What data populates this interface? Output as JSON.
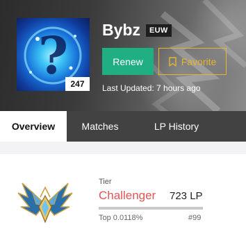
{
  "profile": {
    "name": "Bybz",
    "region": "EUW",
    "level": "247",
    "renew_label": "Renew",
    "favorite_label": "Favorite",
    "last_updated": "Last Updated: 7 hours ago",
    "avatar_icon": "question-mark-orb-icon",
    "favorite_icon": "bookmark-icon"
  },
  "tabs": [
    {
      "label": "Overview",
      "active": true
    },
    {
      "label": "Matches",
      "active": false
    },
    {
      "label": "LP History",
      "active": false
    }
  ],
  "rank": {
    "tier_label": "Tier",
    "tier": "Challenger",
    "lp": "723 LP",
    "top_percent": "Top 0.0118%",
    "position": "#99",
    "emblem_icon": "challenger-emblem-icon"
  },
  "colors": {
    "renew": "#1faf83",
    "favorite": "#e6b532",
    "tier": "#e05555"
  }
}
